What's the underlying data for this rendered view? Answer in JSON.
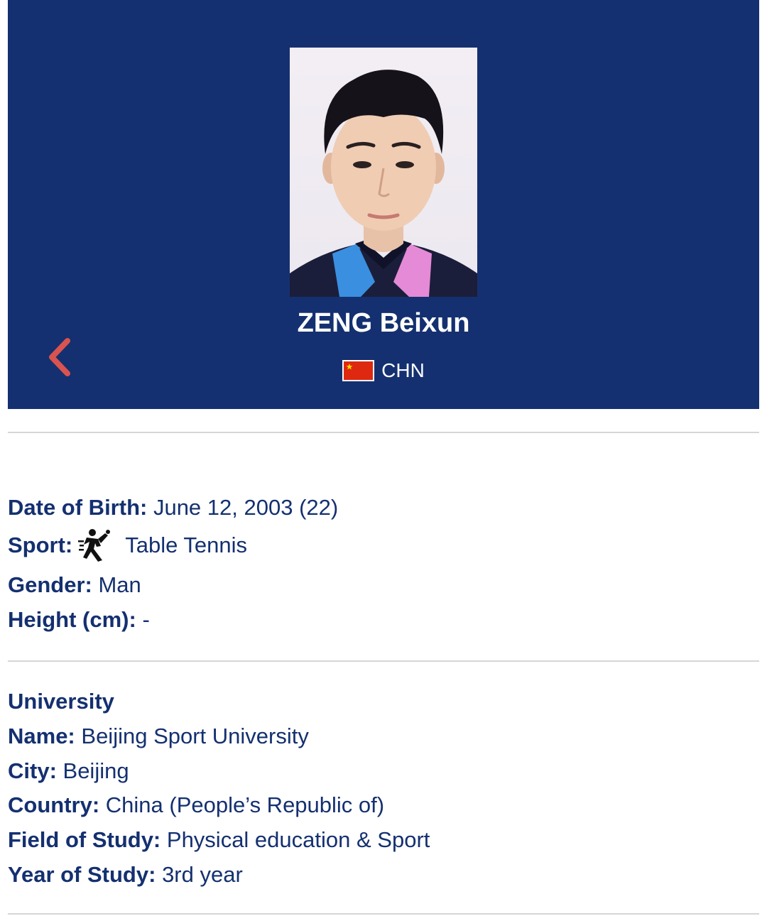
{
  "athlete": {
    "name": "ZENG Beixun",
    "country_code": "CHN",
    "flag_icon": "china-flag-icon"
  },
  "nav": {
    "back_icon": "chevron-left-icon",
    "back_color": "#d9534f"
  },
  "personal": {
    "dob_label": "Date of Birth:",
    "dob_value": "June 12, 2003 (22)",
    "sport_label": "Sport:",
    "sport_icon": "table-tennis-icon",
    "sport_value": "Table Tennis",
    "gender_label": "Gender:",
    "gender_value": "Man",
    "height_label": "Height (cm):",
    "height_value": "-"
  },
  "university": {
    "section_title": "University",
    "name_label": "Name:",
    "name_value": "Beijing Sport University",
    "city_label": "City:",
    "city_value": "Beijing",
    "country_label": "Country:",
    "country_value": "China (People’s Republic of)",
    "field_label": "Field of Study:",
    "field_value": "Physical education & Sport",
    "year_label": "Year of Study:",
    "year_value": "3rd year"
  },
  "colors": {
    "hero_bg": "#143070",
    "text": "#143070",
    "divider": "#d6d6d6"
  }
}
